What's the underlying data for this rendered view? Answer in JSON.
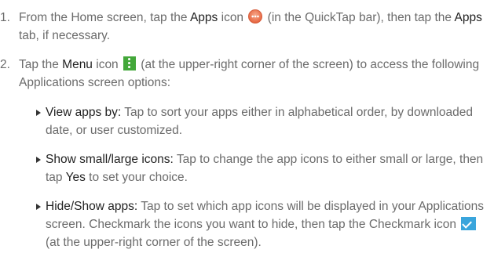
{
  "steps": [
    {
      "number": "1.",
      "t1": "From the Home screen, tap the ",
      "b1": "Apps",
      "t2": " icon ",
      "t3": " (in the QuickTap bar), then tap the ",
      "b2": "Apps",
      "t4": " tab, if necessary."
    },
    {
      "number": "2.",
      "t1": "Tap the ",
      "b1": "Menu",
      "t2": " icon ",
      "t3": " (at the upper-right corner of the screen) to access the following Applications screen options:"
    }
  ],
  "bullets": [
    {
      "label": "View apps by:",
      "text": " Tap to sort your apps either in alphabetical order, by downloaded date, or user customized."
    },
    {
      "label": "Show small/large icons:",
      "text": " Tap to change the app icons to either small or large, then tap ",
      "bold2": "Yes",
      "text2": " to set your choice."
    },
    {
      "label": "Hide/Show apps:",
      "text": " Tap to set which app icons will be displayed in your Applications screen. Checkmark the icons you want to hide, then tap the Checkmark icon ",
      "text2": " (at the upper-right corner of the screen)."
    }
  ],
  "icons": {
    "apps": "apps-icon",
    "menu": "menu-icon",
    "checkmark": "checkmark-icon"
  }
}
